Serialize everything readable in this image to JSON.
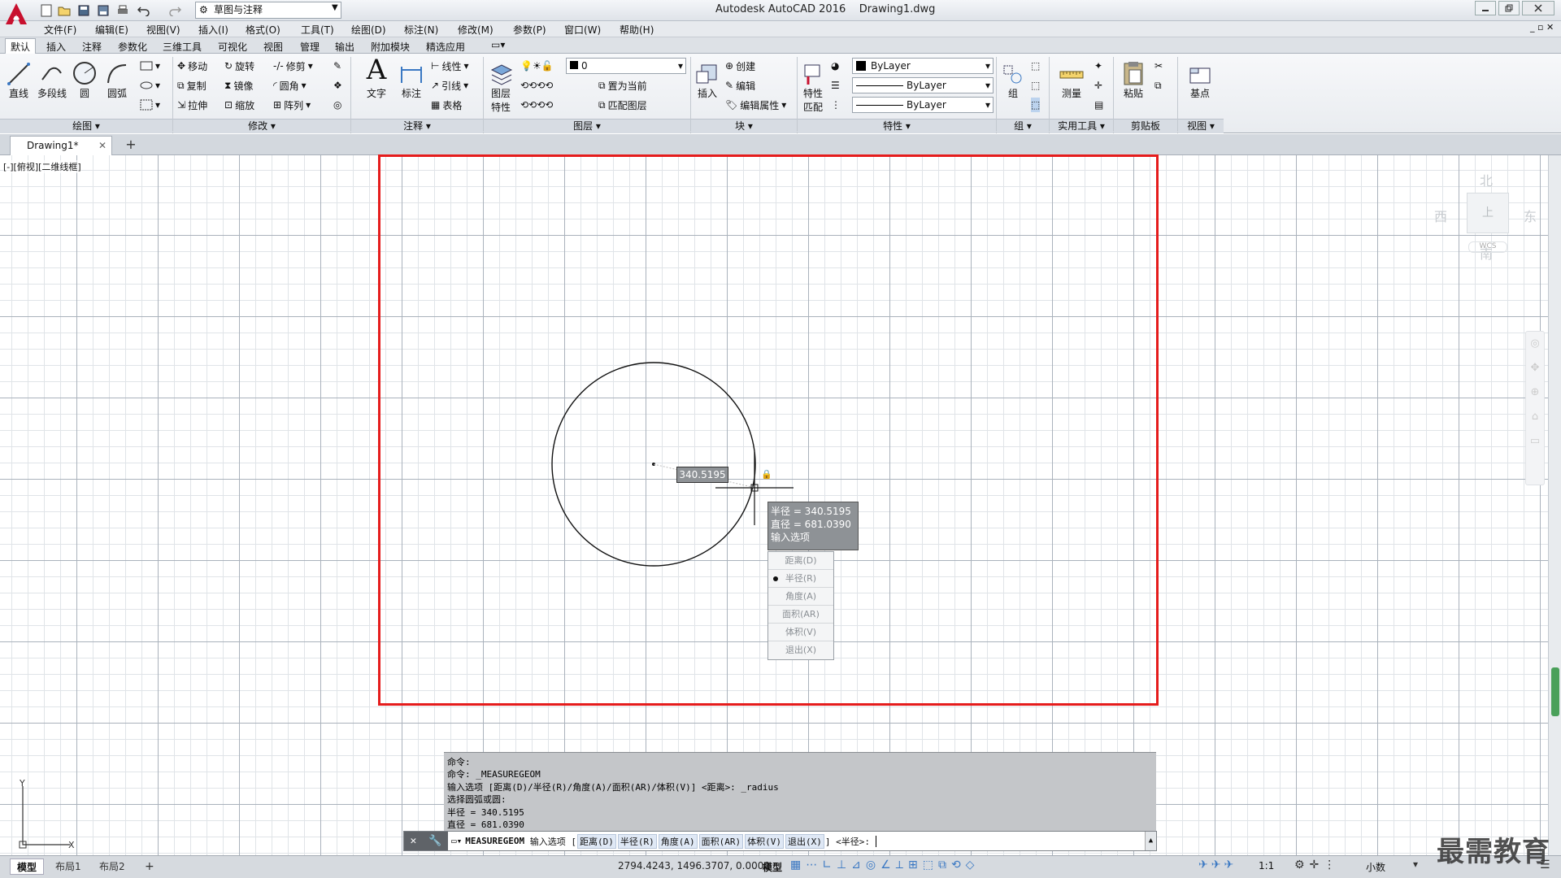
{
  "app": {
    "title": "Autodesk AutoCAD 2016",
    "doc_name": "Drawing1.dwg",
    "workspace": "草图与注释"
  },
  "menu": [
    "文件(F)",
    "编辑(E)",
    "视图(V)",
    "插入(I)",
    "格式(O)",
    "工具(T)",
    "绘图(D)",
    "标注(N)",
    "修改(M)",
    "参数(P)",
    "窗口(W)",
    "帮助(H)"
  ],
  "ribbon_tabs": [
    "默认",
    "插入",
    "注释",
    "参数化",
    "三维工具",
    "可视化",
    "视图",
    "管理",
    "输出",
    "附加模块",
    "精选应用"
  ],
  "ribbon": {
    "draw": {
      "title": "绘图",
      "line": "直线",
      "polyline": "多段线",
      "circle": "圆",
      "arc": "圆弧"
    },
    "modify": {
      "title": "修改",
      "move": "移动",
      "rotate": "旋转",
      "trim": "修剪",
      "copy": "复制",
      "mirror": "镜像",
      "fillet": "圆角",
      "stretch": "拉伸",
      "scale": "缩放",
      "array": "阵列"
    },
    "annotation": {
      "title": "注释",
      "text": "文字",
      "dimension": "标注",
      "linear": "线性",
      "leader": "引线",
      "table": "表格"
    },
    "layers": {
      "title": "图层",
      "layer_props_1": "图层",
      "layer_props_2": "特性",
      "current_layer": "0",
      "set_current": "置为当前",
      "match_layer": "匹配图层"
    },
    "block": {
      "title": "块",
      "insert": "插入",
      "create": "创建",
      "edit": "编辑",
      "edit_attr": "编辑属性"
    },
    "properties": {
      "title": "特性",
      "match_1": "特性",
      "match_2": "匹配",
      "color": "ByLayer",
      "linetype": "ByLayer",
      "lineweight": "ByLayer"
    },
    "groups": {
      "title": "组",
      "group": "组"
    },
    "utilities": {
      "title": "实用工具",
      "measure": "测量"
    },
    "clipboard": {
      "title": "剪贴板",
      "paste": "粘贴"
    },
    "view": {
      "title": "视图",
      "base": "基点"
    }
  },
  "doc_tab": "Drawing1*",
  "viewport_label": "[-][俯视][二维线框]",
  "viewcube": {
    "north": "北",
    "south": "南",
    "east": "东",
    "west": "西",
    "top": "上",
    "wcs": "WCS"
  },
  "dynamic_input_value": "340.5195",
  "tooltip": {
    "line1": "半径 = 340.5195",
    "line2": "直径 = 681.0390",
    "line3": "输入选项"
  },
  "options_menu": [
    {
      "label": "距离(D)",
      "selected": false
    },
    {
      "label": "半径(R)",
      "selected": true
    },
    {
      "label": "角度(A)",
      "selected": false
    },
    {
      "label": "面积(AR)",
      "selected": false
    },
    {
      "label": "体积(V)",
      "selected": false
    },
    {
      "label": "退出(X)",
      "selected": false
    }
  ],
  "history": [
    "命令:",
    "命令: _MEASUREGEOM",
    "输入选项 [距离(D)/半径(R)/角度(A)/面积(AR)/体积(V)] <距离>: _radius",
    "选择圆弧或圆:",
    "半径 = 340.5195",
    "直径 = 681.0390"
  ],
  "command_line": {
    "command": "MEASUREGEOM",
    "prompt": "输入选项 [",
    "opts": [
      "距离(D)",
      "半径(R)",
      "角度(A)",
      "面积(AR)",
      "体积(V)",
      "退出(X)"
    ],
    "tail": "] <半径>:"
  },
  "layout_tabs": [
    "模型",
    "布局1",
    "布局2"
  ],
  "status": {
    "coords": "2794.4243, 1496.3707, 0.0000",
    "model": "模型",
    "scale": "1:1",
    "units": "小数"
  },
  "watermark": "最需教育",
  "colors": {
    "frame": "#e51c1c",
    "accent": "#c8102e"
  }
}
